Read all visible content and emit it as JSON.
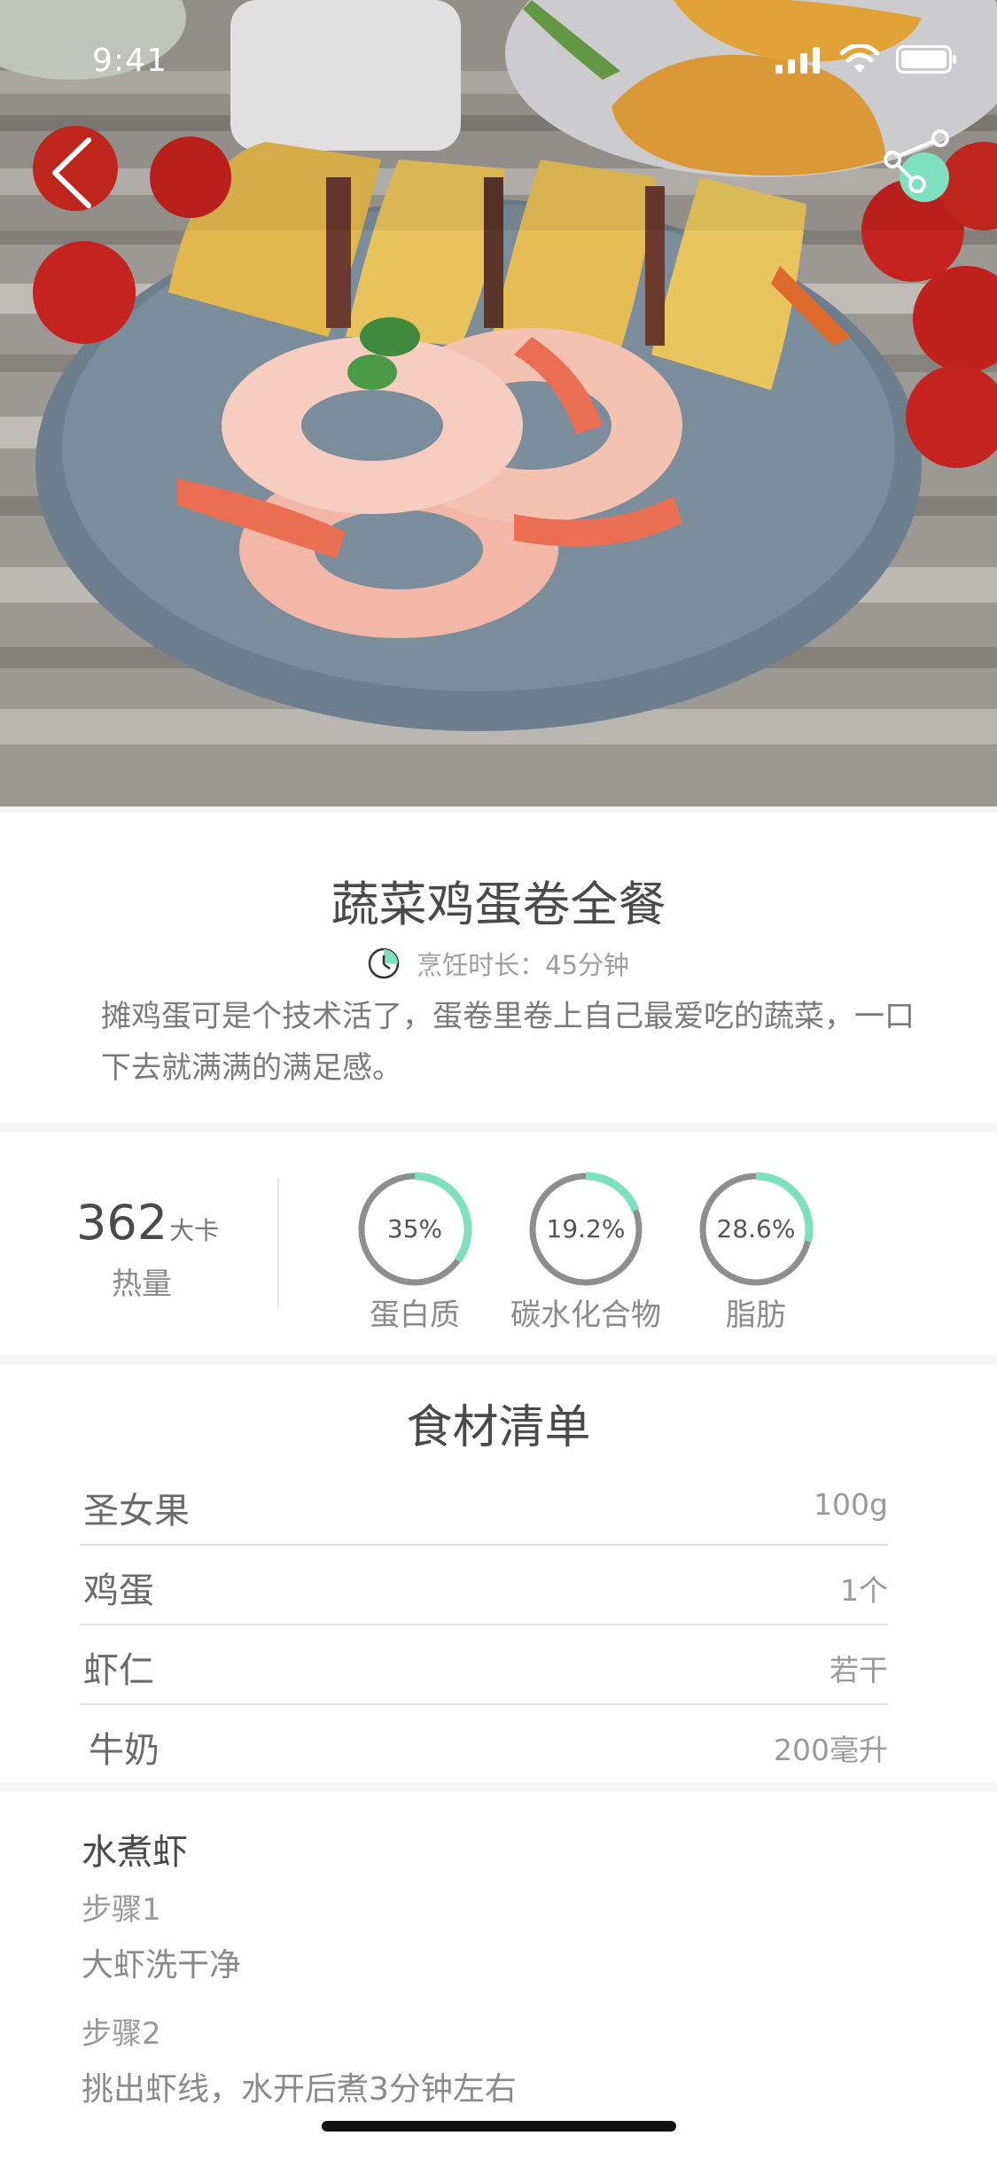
{
  "status_bar": {
    "time": "9:41"
  },
  "recipe": {
    "title": "蔬菜鸡蛋卷全餐",
    "cook_time": "烹饪时长：45分钟",
    "description": "摊鸡蛋可是个技术活了，蛋卷里卷上自己最爱吃的蔬菜，一口下去就满满的满足感。"
  },
  "nutrition": {
    "calories_value": "362",
    "calories_unit": "大卡",
    "calories_label": "热量",
    "items": [
      {
        "label": "蛋白质",
        "percent_text": "35%",
        "value": 0.35
      },
      {
        "label": "碳水化合物",
        "percent_text": "19.2%",
        "value": 0.192
      },
      {
        "label": "脂肪",
        "percent_text": "28.6%",
        "value": 0.286
      }
    ]
  },
  "ingredients": {
    "title": "食材清单",
    "items": [
      {
        "name": "圣女果",
        "amount": "100g"
      },
      {
        "name": "鸡蛋",
        "amount": "1个"
      },
      {
        "name": "虾仁",
        "amount": "若干"
      },
      {
        "name": "牛奶",
        "amount": "200毫升"
      }
    ]
  },
  "steps": {
    "section_title": "水煮虾",
    "items": [
      {
        "label": "步骤1",
        "text": "大虾洗干净"
      },
      {
        "label": "步骤2",
        "text": "挑出虾线，水开后煮3分钟左右"
      }
    ]
  },
  "colors": {
    "accent": "#7fe0c0",
    "ring_track": "#8e8e8e"
  },
  "icons": {
    "back": "chevron-left-icon",
    "share": "share-icon",
    "clock": "clock-icon",
    "signal": "signal-icon",
    "wifi": "wifi-icon",
    "battery": "battery-icon"
  }
}
